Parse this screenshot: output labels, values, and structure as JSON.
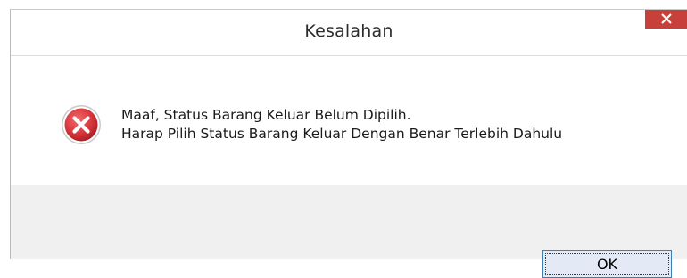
{
  "dialog": {
    "title": "Kesalahan",
    "close_icon": "close-icon",
    "icon": "error-icon",
    "message_lines": [
      "Maaf, Status Barang Keluar Belum Dipilih.",
      "Harap Pilih Status Barang Keluar Dengan Benar Terlebih Dahulu"
    ],
    "ok_label": "OK",
    "colors": {
      "close_button": "#c7403a",
      "footer": "#f0f0f0",
      "error_icon": "#d8363b",
      "ok_border": "#3c7fb1"
    }
  }
}
